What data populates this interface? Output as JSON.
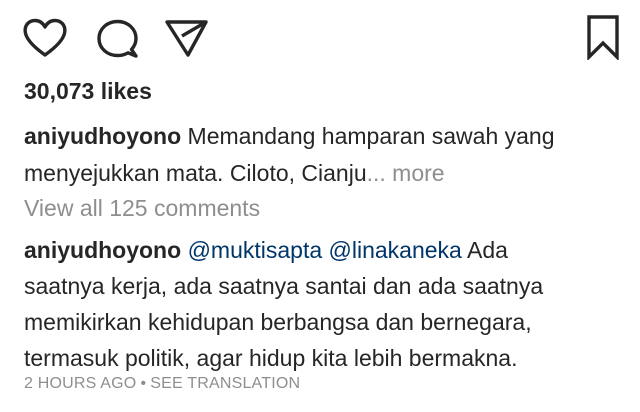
{
  "actions": {
    "icons": [
      "heart-icon",
      "comment-icon",
      "share-icon",
      "bookmark-icon"
    ]
  },
  "likes": "30,073 likes",
  "caption": {
    "username": "aniyudhoyono",
    "text_line1": " Memandang hamparan sawah yang",
    "text_line2": "menyejukkan mata. Ciloto, Cianju",
    "ellipsis": "...",
    "more": " more"
  },
  "view_all_comments": "View all 125 comments",
  "comment": {
    "username": "aniyudhoyono",
    "mention1": "@muktisapta",
    "mention2": "@linakaneka",
    "text_line1_end": " Ada",
    "line2": "saatnya kerja, ada saatnya santai dan ada saatnya",
    "line3": "memikirkan kehidupan berbangsa dan bernegara,",
    "line4": "termasuk politik, agar hidup kita lebih bermakna."
  },
  "footer": {
    "time": "2 HOURS AGO",
    "separator": "•",
    "translate": "SEE TRANSLATION"
  },
  "colors": {
    "text": "#262626",
    "muted": "#8e8e8e",
    "mention": "#003569"
  }
}
